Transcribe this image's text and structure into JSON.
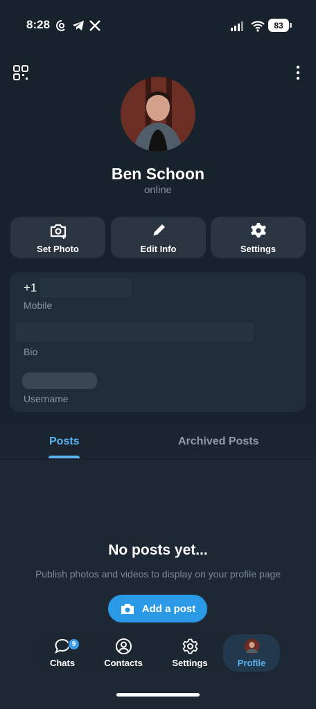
{
  "status_bar": {
    "time": "8:28",
    "battery": "83"
  },
  "profile": {
    "name": "Ben Schoon",
    "status": "online"
  },
  "actions": [
    {
      "label": "Set Photo",
      "icon": "camera-add-icon"
    },
    {
      "label": "Edit Info",
      "icon": "pencil-icon"
    },
    {
      "label": "Settings",
      "icon": "gear-icon"
    }
  ],
  "info": {
    "phone_prefix": "+1",
    "phone_label": "Mobile",
    "bio_label": "Bio",
    "username_label": "Username"
  },
  "tabs": {
    "posts": "Posts",
    "archived": "Archived Posts"
  },
  "empty_state": {
    "title": "No posts yet...",
    "description": "Publish photos and videos to display on your profile page",
    "button": "Add a post"
  },
  "bottom_nav": {
    "chats": "Chats",
    "chats_badge": "9",
    "contacts": "Contacts",
    "settings": "Settings",
    "profile": "Profile"
  },
  "colors": {
    "accent": "#5ab3f0",
    "button": "#2a9ae6",
    "background": "#18222d"
  }
}
